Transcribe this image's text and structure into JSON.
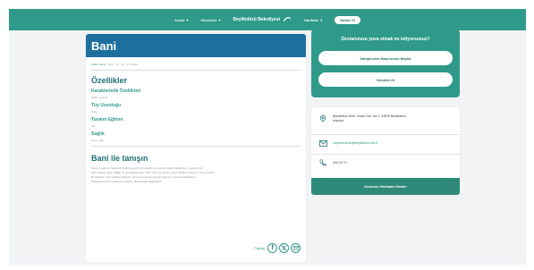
{
  "topbar": {
    "nav_items": [
      "Anılar",
      "Hizmetler"
    ],
    "brand": "Beylikdüzü Belediyesi",
    "menu_item": "Haritalar",
    "pill": "Nöbet Ol"
  },
  "left": {
    "title": "Bani",
    "breadcrumb": [
      "Kültür Sanat",
      "Köy",
      "Irk",
      "Irk",
      "1.5 Başlık"
    ],
    "features_title": "Özellikler",
    "features": [
      {
        "title": "Karakteristik Özellikleri",
        "value": "Güler, sevimli"
      },
      {
        "title": "Tüy Uzunluğu",
        "value": "Kısa"
      },
      {
        "title": "Tuvalet Eğitimi",
        "value": "Var"
      },
      {
        "title": "Sağlık",
        "value": "Uzun yaşlı"
      }
    ],
    "intro_title": "Bani ile tanışın",
    "intro_lines": [
      "Sevgi, neşeli ve hareketli, küçük boyutlu bir köpektir ve çok sevimlidir. Aileleriyle iyi geçinir, her",
      "türlü ortama uyum sağlar ve çocuklarla arası iyidir. Oyun oynamayı sever. Bakımı kolaydır. Uzun ömürlü",
      "bir köpektir. Yeni sahibini bekliyor; onunla tanışmak için barınağımızı ziyaret edebilirsiniz.",
      "Sahiplenmek için iletişime geçebilir, detaylı bilgi alabilirsiniz."
    ],
    "share_label": "Paylaş"
  },
  "cta": {
    "question": "Destanımıza yuva olmak mı istiyorsunuz?",
    "button1": "Sahiplenme Başvurusu Başlat",
    "button2": "Gönüllü Ol"
  },
  "contact": {
    "address": [
      "Beylikdüzü Mah. Ziraat Cad. No:1, 34520 Beylikdüzü",
      "İstanbul"
    ],
    "email": "hayvanhaklari@beylikduzu.bel.tr",
    "phone": "444 00 70",
    "map_button": "Konumu Haritada Göster"
  },
  "colors": {
    "teal": "#2f9a8a",
    "blue": "#1f6f9e"
  }
}
